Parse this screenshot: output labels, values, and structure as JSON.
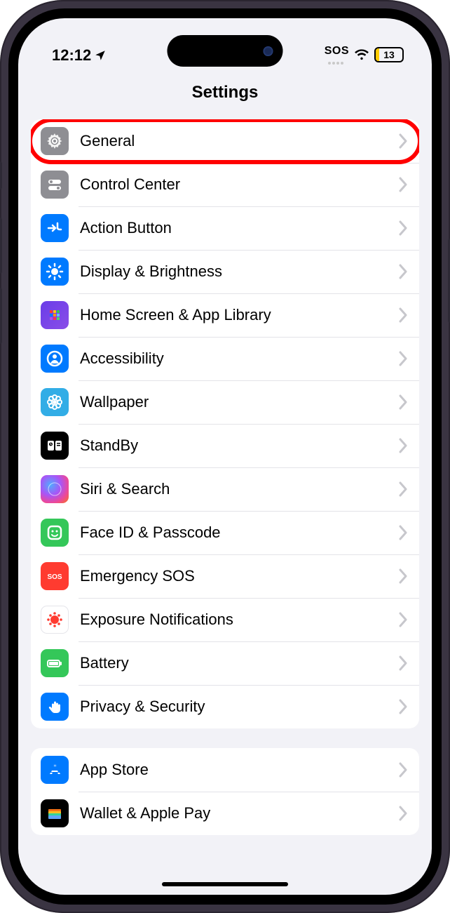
{
  "status": {
    "time": "12:12",
    "sos": "SOS",
    "battery_pct": "13",
    "battery_fill_pct": 13
  },
  "nav": {
    "title": "Settings"
  },
  "groups": [
    {
      "rows": [
        {
          "id": "general",
          "label": "General",
          "icon": "gear",
          "bg": "bg-gray",
          "highlight": true
        },
        {
          "id": "control-center",
          "label": "Control Center",
          "icon": "switches",
          "bg": "bg-gray"
        },
        {
          "id": "action-button",
          "label": "Action Button",
          "icon": "action",
          "bg": "bg-blue"
        },
        {
          "id": "display",
          "label": "Display & Brightness",
          "icon": "sun",
          "bg": "bg-blue"
        },
        {
          "id": "homescreen",
          "label": "Home Screen & App Library",
          "icon": "grid",
          "bg": "bg-purple"
        },
        {
          "id": "accessibility",
          "label": "Accessibility",
          "icon": "person-circle",
          "bg": "bg-blue"
        },
        {
          "id": "wallpaper",
          "label": "Wallpaper",
          "icon": "flower",
          "bg": "bg-cyan"
        },
        {
          "id": "standby",
          "label": "StandBy",
          "icon": "clock-card",
          "bg": "bg-black"
        },
        {
          "id": "siri",
          "label": "Siri & Search",
          "icon": "siri",
          "bg": "bg-siri"
        },
        {
          "id": "faceid",
          "label": "Face ID & Passcode",
          "icon": "face",
          "bg": "bg-green"
        },
        {
          "id": "emergency",
          "label": "Emergency SOS",
          "icon": "sos",
          "bg": "bg-red"
        },
        {
          "id": "exposure",
          "label": "Exposure Notifications",
          "icon": "virus",
          "bg": "bg-white"
        },
        {
          "id": "battery",
          "label": "Battery",
          "icon": "battery",
          "bg": "bg-green"
        },
        {
          "id": "privacy",
          "label": "Privacy & Security",
          "icon": "hand",
          "bg": "bg-blue"
        }
      ]
    },
    {
      "rows": [
        {
          "id": "appstore",
          "label": "App Store",
          "icon": "appstore",
          "bg": "bg-blue"
        },
        {
          "id": "wallet",
          "label": "Wallet & Apple Pay",
          "icon": "wallet",
          "bg": "bg-wallet"
        }
      ]
    }
  ]
}
